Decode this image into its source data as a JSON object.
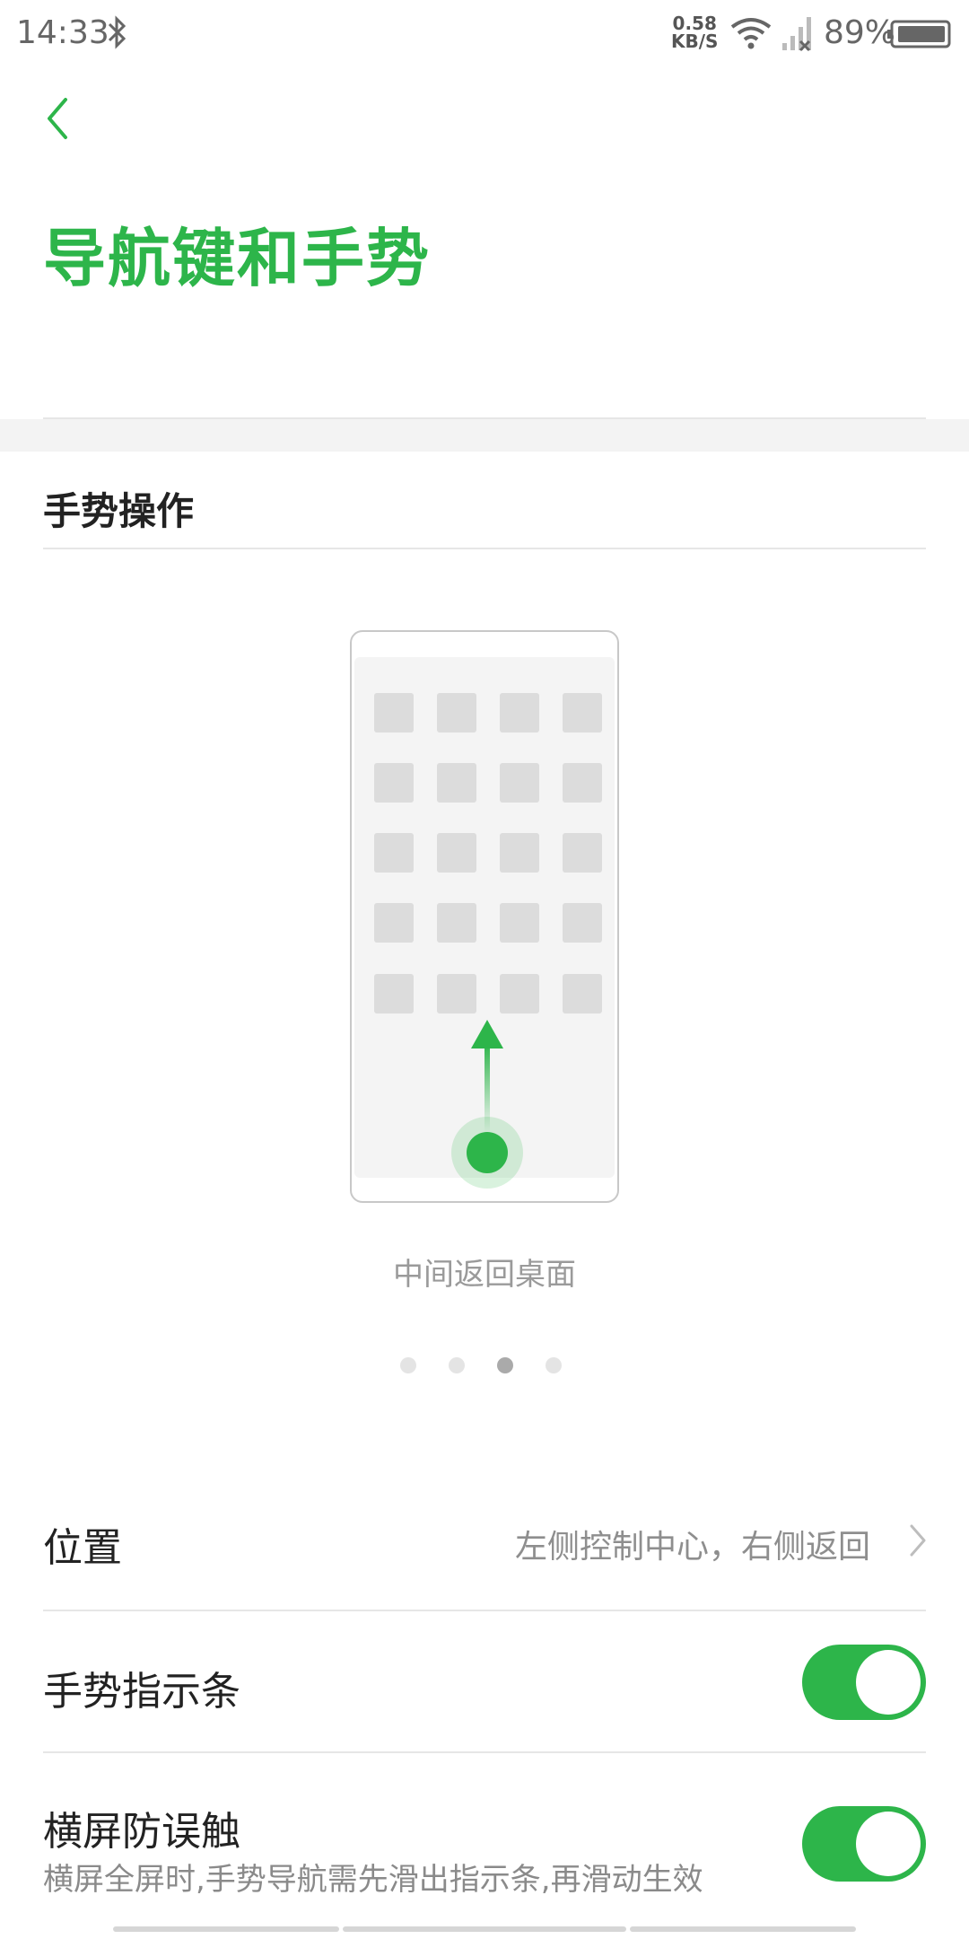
{
  "status_bar": {
    "time": "14:33",
    "net_speed_value": "0.58",
    "net_speed_unit": "KB/S",
    "battery": "89%"
  },
  "header": {
    "title": "导航键和手势"
  },
  "section": {
    "title": "手势操作"
  },
  "illustration": {
    "caption": "中间返回桌面",
    "page_count": 4,
    "active_page": 3
  },
  "settings": {
    "position": {
      "label": "位置",
      "value": "左侧控制中心，右侧返回"
    },
    "gesture_bar": {
      "label": "手势指示条",
      "enabled": true
    },
    "landscape_guard": {
      "label": "横屏防误触",
      "description": "横屏全屏时,手势导航需先滑出指示条,再滑动生效",
      "enabled": true
    }
  },
  "colors": {
    "accent": "#2db54a",
    "text_primary": "#222222",
    "text_secondary": "#8e8e8e"
  }
}
